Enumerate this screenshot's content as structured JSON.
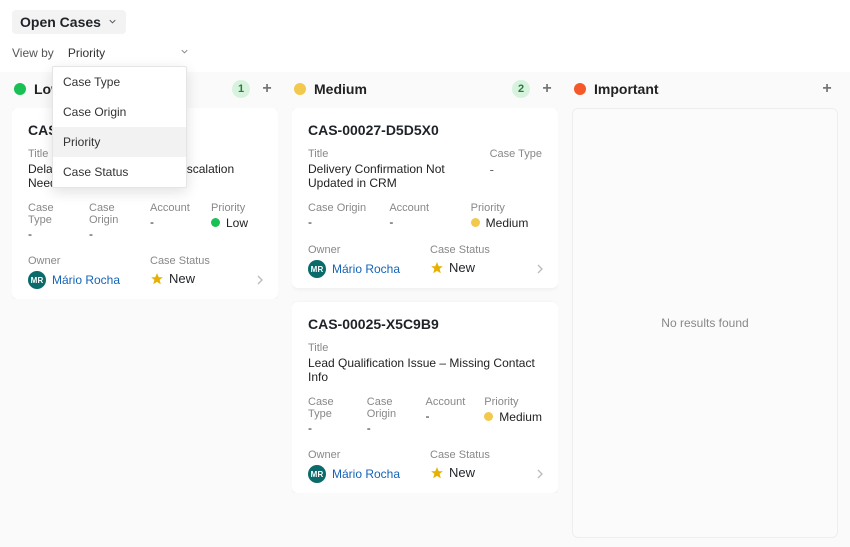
{
  "header": {
    "view_title": "Open Cases",
    "viewby_label": "View by",
    "viewby_value": "Priority"
  },
  "dropdown": {
    "options": [
      "Case Type",
      "Case Origin",
      "Priority",
      "Case Status"
    ],
    "selected": "Priority"
  },
  "columns": [
    {
      "key": "low",
      "label": "Low",
      "color": "#19c155",
      "count": 1,
      "cards": [
        {
          "id": "CAS-",
          "title_label": "Title",
          "title": "Delayed Shipment – Urgent Escalation Needed",
          "fields4": [
            {
              "label": "Case Type",
              "value": "-"
            },
            {
              "label": "Case Origin",
              "value": "-"
            },
            {
              "label": "Account",
              "value": "-"
            },
            {
              "label": "Priority",
              "value": "Low",
              "dot": "#19c155"
            }
          ],
          "owner_label": "Owner",
          "owner_initials": "MR",
          "owner_name": "Mário Rocha",
          "status_label": "Case Status",
          "status_value": "New"
        }
      ]
    },
    {
      "key": "medium",
      "label": "Medium",
      "color": "#f2c94c",
      "count": 2,
      "cards": [
        {
          "id": "CAS-00027-D5D5X0",
          "title_label": "Title",
          "title": "Delivery Confirmation Not Updated in CRM",
          "case_type_label": "Case Type",
          "case_type_value": "-",
          "fields3": [
            {
              "label": "Case Origin",
              "value": "-"
            },
            {
              "label": "Account",
              "value": "-"
            },
            {
              "label": "Priority",
              "value": "Medium",
              "dot": "#f2c94c"
            }
          ],
          "owner_label": "Owner",
          "owner_initials": "MR",
          "owner_name": "Mário Rocha",
          "status_label": "Case Status",
          "status_value": "New"
        },
        {
          "id": "CAS-00025-X5C9B9",
          "title_label": "Title",
          "title": "Lead Qualification Issue – Missing Contact Info",
          "fields4": [
            {
              "label": "Case Type",
              "value": "-"
            },
            {
              "label": "Case Origin",
              "value": "-"
            },
            {
              "label": "Account",
              "value": "-"
            },
            {
              "label": "Priority",
              "value": "Medium",
              "dot": "#f2c94c"
            }
          ],
          "owner_label": "Owner",
          "owner_initials": "MR",
          "owner_name": "Mário Rocha",
          "status_label": "Case Status",
          "status_value": "New"
        }
      ]
    },
    {
      "key": "important",
      "label": "Important",
      "color": "#f5592a",
      "empty_text": "No results found"
    }
  ]
}
